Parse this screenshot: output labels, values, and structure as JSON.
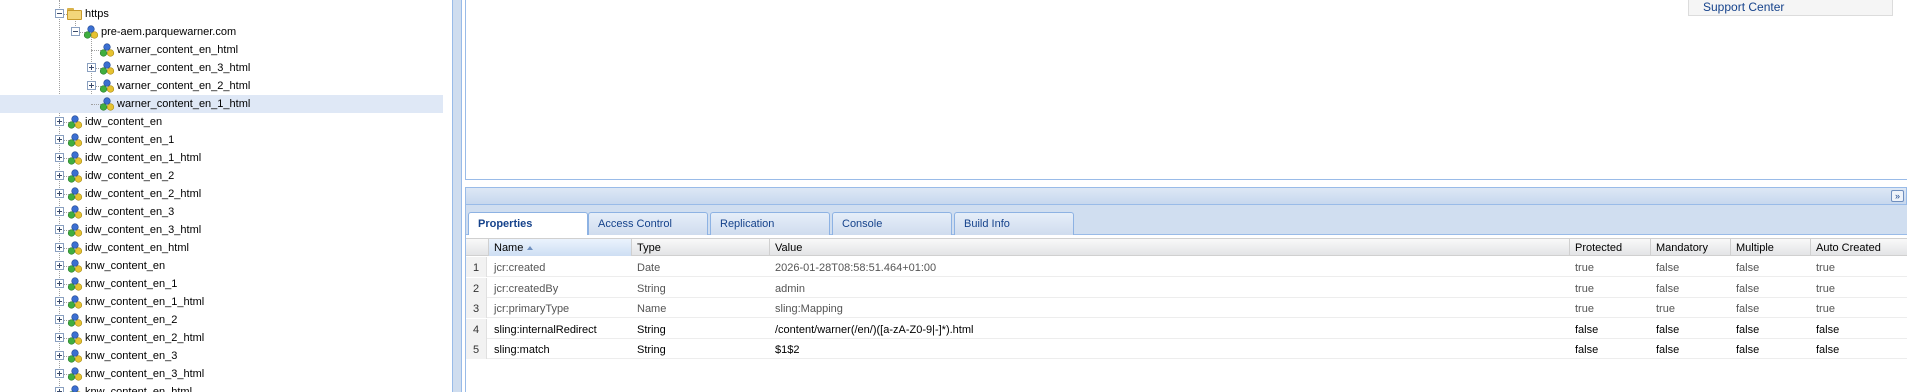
{
  "tree": {
    "nodes": [
      {
        "label": "https",
        "depth": 0,
        "toggle": "minus",
        "icon": "folder-icon"
      },
      {
        "label": "pre-aem.parquewarner.com",
        "depth": 1,
        "toggle": "minus",
        "icon": "mapping-node-icon"
      },
      {
        "label": "warner_content_en_html",
        "depth": 2,
        "toggle": "none",
        "icon": "mapping-node-icon"
      },
      {
        "label": "warner_content_en_3_html",
        "depth": 2,
        "toggle": "plus",
        "icon": "mapping-node-icon"
      },
      {
        "label": "warner_content_en_2_html",
        "depth": 2,
        "toggle": "plus",
        "icon": "mapping-node-icon"
      },
      {
        "label": "warner_content_en_1_html",
        "depth": 2,
        "toggle": "none",
        "icon": "mapping-node-icon",
        "selected": true
      },
      {
        "label": "idw_content_en",
        "depth": 0,
        "toggle": "plus",
        "icon": "mapping-node-icon"
      },
      {
        "label": "idw_content_en_1",
        "depth": 0,
        "toggle": "plus",
        "icon": "mapping-node-icon"
      },
      {
        "label": "idw_content_en_1_html",
        "depth": 0,
        "toggle": "plus",
        "icon": "mapping-node-icon"
      },
      {
        "label": "idw_content_en_2",
        "depth": 0,
        "toggle": "plus",
        "icon": "mapping-node-icon"
      },
      {
        "label": "idw_content_en_2_html",
        "depth": 0,
        "toggle": "plus",
        "icon": "mapping-node-icon"
      },
      {
        "label": "idw_content_en_3",
        "depth": 0,
        "toggle": "plus",
        "icon": "mapping-node-icon"
      },
      {
        "label": "idw_content_en_3_html",
        "depth": 0,
        "toggle": "plus",
        "icon": "mapping-node-icon"
      },
      {
        "label": "idw_content_en_html",
        "depth": 0,
        "toggle": "plus",
        "icon": "mapping-node-icon"
      },
      {
        "label": "knw_content_en",
        "depth": 0,
        "toggle": "plus",
        "icon": "mapping-node-icon"
      },
      {
        "label": "knw_content_en_1",
        "depth": 0,
        "toggle": "plus",
        "icon": "mapping-node-icon"
      },
      {
        "label": "knw_content_en_1_html",
        "depth": 0,
        "toggle": "plus",
        "icon": "mapping-node-icon"
      },
      {
        "label": "knw_content_en_2",
        "depth": 0,
        "toggle": "plus",
        "icon": "mapping-node-icon"
      },
      {
        "label": "knw_content_en_2_html",
        "depth": 0,
        "toggle": "plus",
        "icon": "mapping-node-icon"
      },
      {
        "label": "knw_content_en_3",
        "depth": 0,
        "toggle": "plus",
        "icon": "mapping-node-icon"
      },
      {
        "label": "knw_content_en_3_html",
        "depth": 0,
        "toggle": "plus",
        "icon": "mapping-node-icon"
      },
      {
        "label": "knw_content_en_html",
        "depth": 0,
        "toggle": "plus",
        "icon": "mapping-node-icon"
      }
    ]
  },
  "header_links": {
    "support_center": "Support Center"
  },
  "tabs": [
    {
      "label": "Properties",
      "active": true
    },
    {
      "label": "Access Control",
      "active": false
    },
    {
      "label": "Replication",
      "active": false
    },
    {
      "label": "Console",
      "active": false
    },
    {
      "label": "Build Info",
      "active": false
    }
  ],
  "grid": {
    "columns": [
      "",
      "Name",
      "Type",
      "Value",
      "Protected",
      "Mandatory",
      "Multiple",
      "Auto Created"
    ],
    "sorted_column": "Name",
    "rows": [
      {
        "num": "1",
        "name": "jcr:created",
        "type": "Date",
        "value": "2026-01-28T08:58:51.464+01:00",
        "protected": "true",
        "mandatory": "false",
        "multiple": "false",
        "auto_created": "true",
        "strong": false
      },
      {
        "num": "2",
        "name": "jcr:createdBy",
        "type": "String",
        "value": "admin",
        "protected": "true",
        "mandatory": "false",
        "multiple": "false",
        "auto_created": "true",
        "strong": false
      },
      {
        "num": "3",
        "name": "jcr:primaryType",
        "type": "Name",
        "value": "sling:Mapping",
        "protected": "true",
        "mandatory": "true",
        "multiple": "false",
        "auto_created": "true",
        "strong": false
      },
      {
        "num": "4",
        "name": "sling:internalRedirect",
        "type": "String",
        "value": "/content/warner(/en/)([a-zA-Z0-9|-]*).html",
        "protected": "false",
        "mandatory": "false",
        "multiple": "false",
        "auto_created": "false",
        "strong": true
      },
      {
        "num": "5",
        "name": "sling:match",
        "type": "String",
        "value": "$1$2",
        "protected": "false",
        "mandatory": "false",
        "multiple": "false",
        "auto_created": "false",
        "strong": true
      }
    ]
  },
  "colors": {
    "accent": "#15428b",
    "border": "#99bbe8",
    "selected_row": "#dfe8f6"
  }
}
